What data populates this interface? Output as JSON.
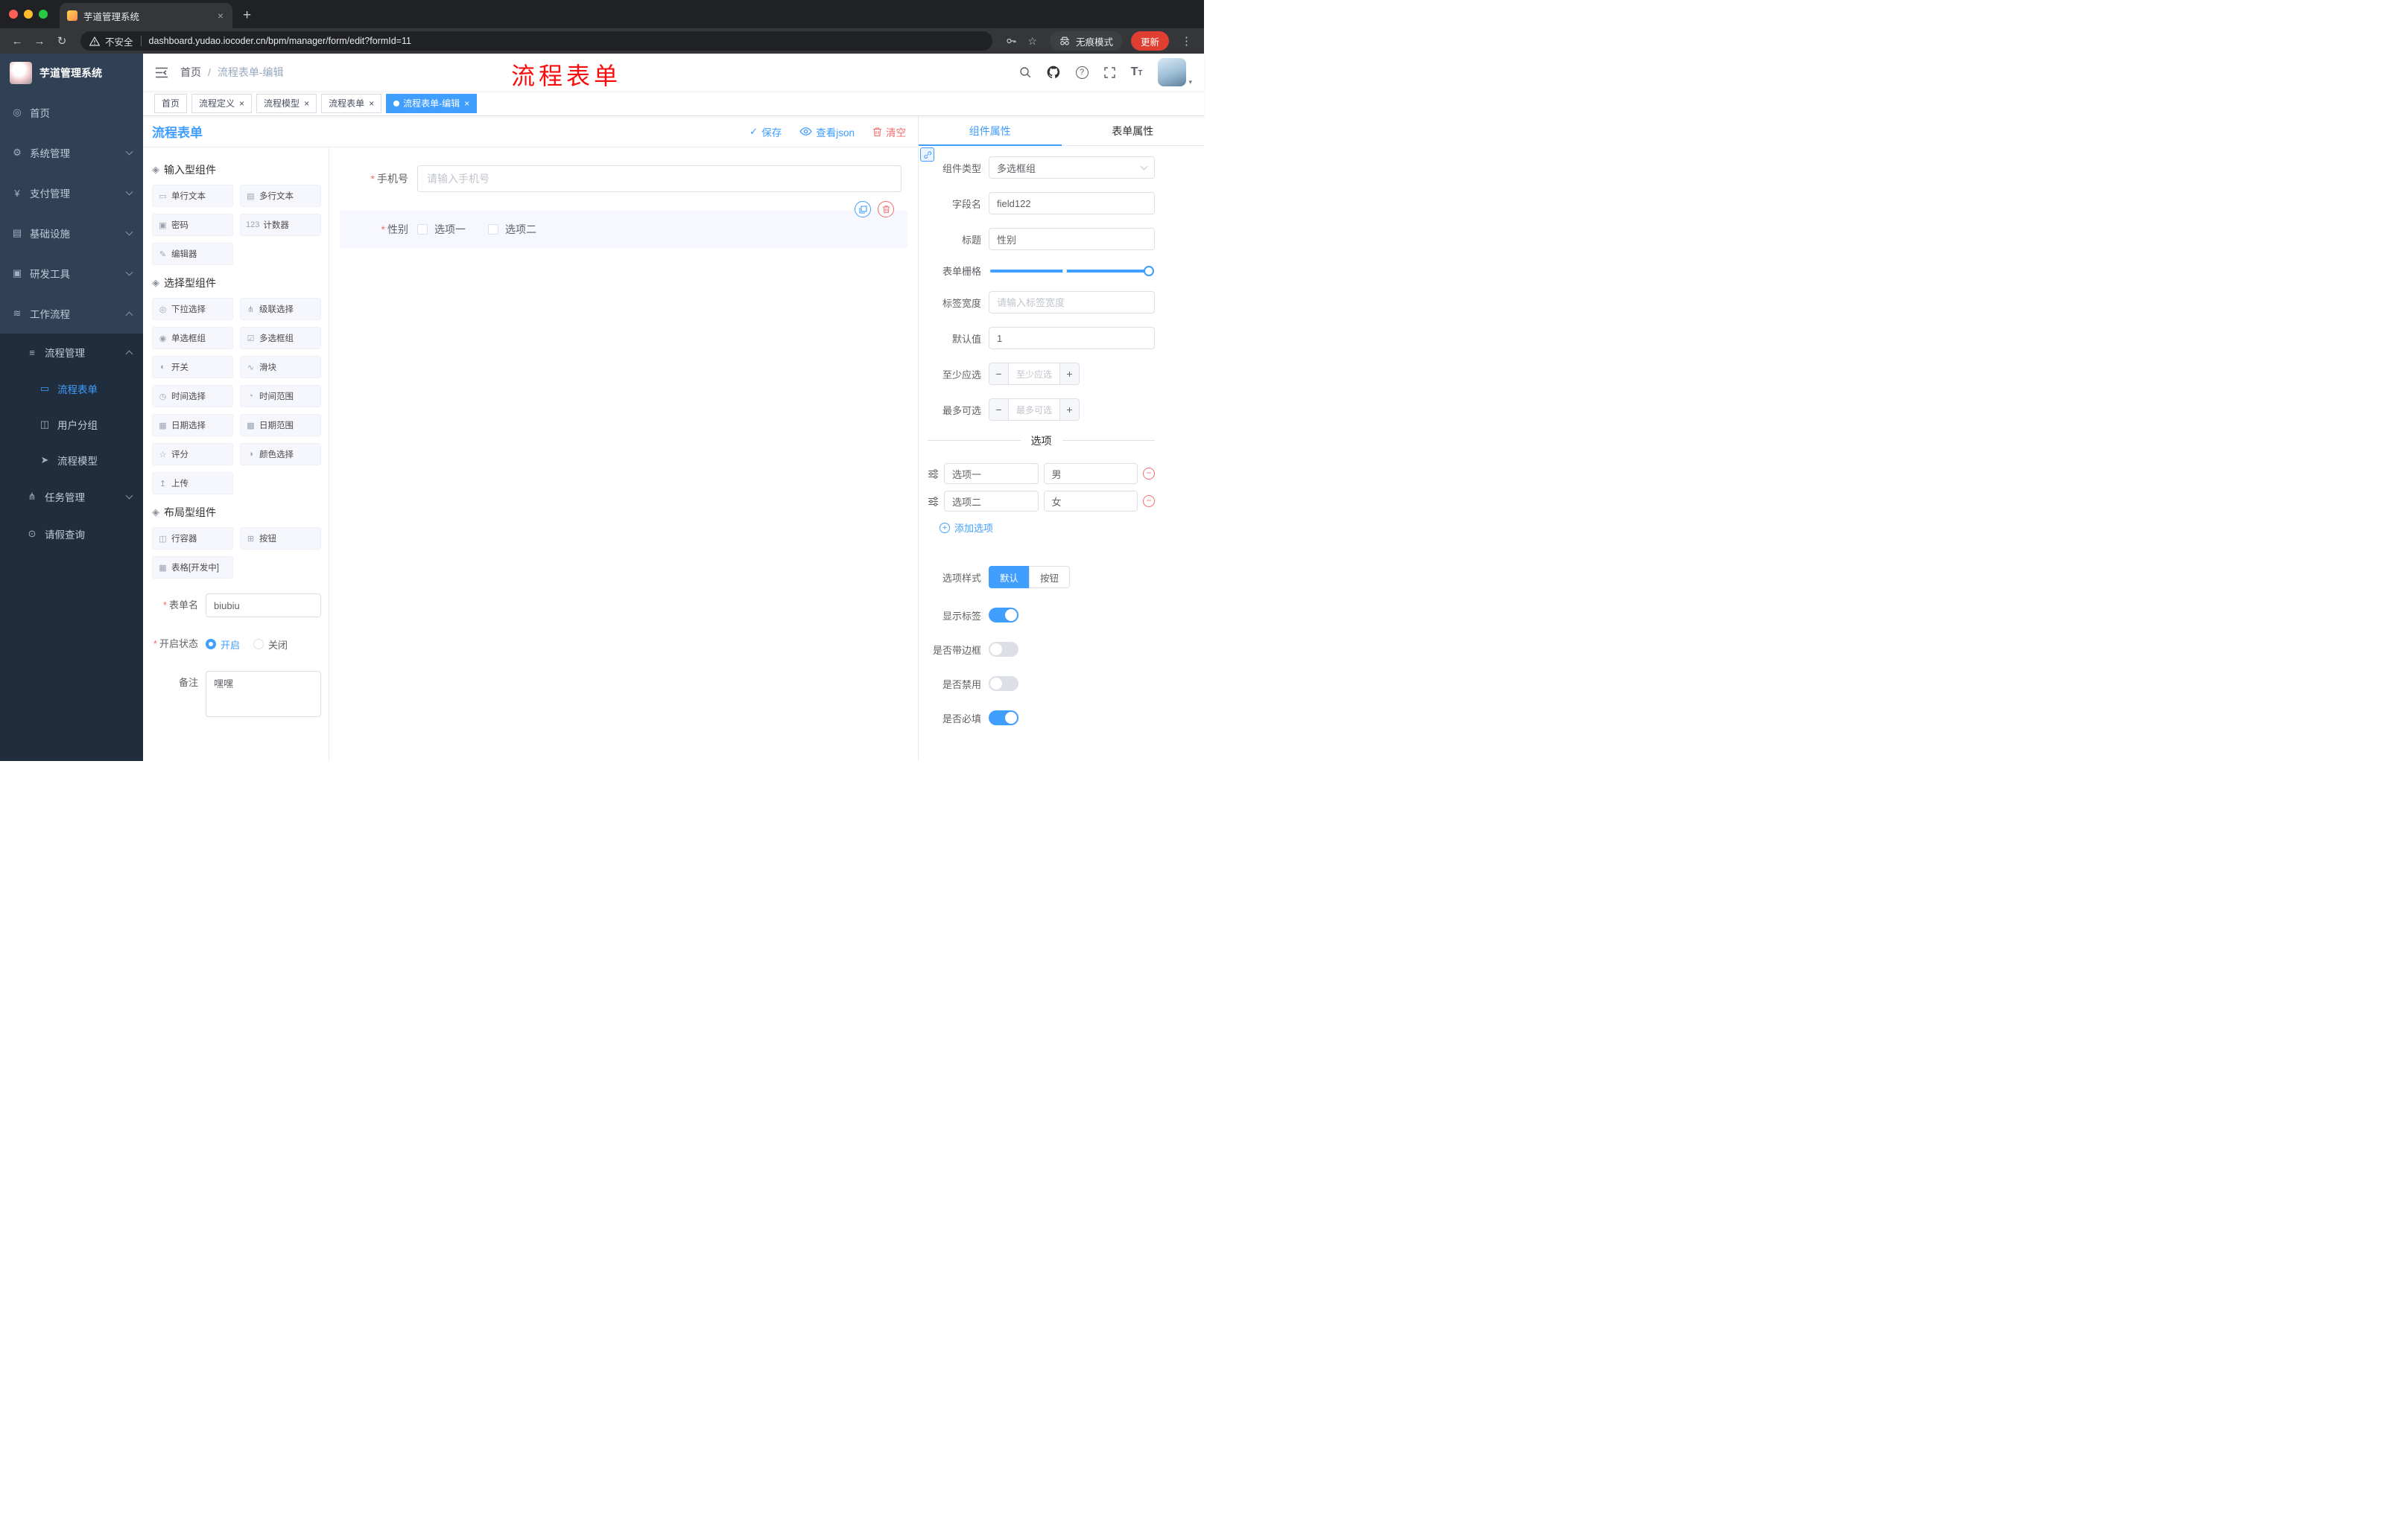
{
  "colors": {
    "accent": "#409eff",
    "danger": "#f56c6c",
    "sidebar_bg": "#304156",
    "submenu_bg": "#1f2d3d",
    "active_tag_bg": "#409eff",
    "update_button_bg": "#df3e30",
    "annotation_color": "#f70d0d"
  },
  "browser": {
    "tab_title": "芋道管理系统",
    "new_tab_label": "+",
    "security_label": "不安全",
    "url": "dashboard.yudao.iocoder.cn/bpm/manager/form/edit?formId=11",
    "incognito_label": "无痕模式",
    "update_label": "更新"
  },
  "icons": {
    "back": "←",
    "forward": "→",
    "reload": "↻",
    "kebab": "⋮",
    "star": "☆",
    "close": "×",
    "check": "✓",
    "question": "?",
    "section": "◈",
    "caret": "▾",
    "minus": "−",
    "plus": "+"
  },
  "annotation": {
    "text": "流程表单"
  },
  "sidebar": {
    "logo_title": "芋道管理系统",
    "items": [
      {
        "label": "首页",
        "icon": "◎"
      },
      {
        "label": "系统管理",
        "icon": "⚙"
      },
      {
        "label": "支付管理",
        "icon": "¥"
      },
      {
        "label": "基础设施",
        "icon": "▤"
      },
      {
        "label": "研发工具",
        "icon": "▣"
      },
      {
        "label": "工作流程",
        "icon": "≋"
      },
      {
        "label": "流程管理",
        "icon": "≡"
      },
      {
        "label": "流程表单",
        "icon": "▭"
      },
      {
        "label": "用户分组",
        "icon": "◫"
      },
      {
        "label": "流程模型",
        "icon": "➤"
      },
      {
        "label": "任务管理",
        "icon": "⋔"
      },
      {
        "label": "请假查询",
        "icon": "⊙"
      }
    ]
  },
  "navbar": {
    "breadcrumb_home": "首页",
    "breadcrumb_sep": "/",
    "breadcrumb_current": "流程表单-编辑"
  },
  "tags": [
    {
      "label": "首页"
    },
    {
      "label": "流程定义"
    },
    {
      "label": "流程模型"
    },
    {
      "label": "流程表单"
    },
    {
      "label": "流程表单-编辑"
    }
  ],
  "designer": {
    "title": "流程表单",
    "save_label": "保存",
    "view_json_label": "查看json",
    "clear_label": "清空"
  },
  "palette": {
    "sections": [
      {
        "title": "输入型组件",
        "items": [
          {
            "label": "单行文本",
            "icon": "▭"
          },
          {
            "label": "多行文本",
            "icon": "▤"
          },
          {
            "label": "密码",
            "icon": "▣"
          },
          {
            "label": "计数器",
            "icon": "123"
          },
          {
            "label": "编辑器",
            "icon": "✎"
          }
        ]
      },
      {
        "title": "选择型组件",
        "items": [
          {
            "label": "下拉选择",
            "icon": "◎"
          },
          {
            "label": "级联选择",
            "icon": "⋔"
          },
          {
            "label": "单选框组",
            "icon": "◉"
          },
          {
            "label": "多选框组",
            "icon": "☑"
          },
          {
            "label": "开关",
            "icon": "◐"
          },
          {
            "label": "滑块",
            "icon": "∿"
          },
          {
            "label": "时间选择",
            "icon": "◷"
          },
          {
            "label": "时间范围",
            "icon": "◔"
          },
          {
            "label": "日期选择",
            "icon": "▦"
          },
          {
            "label": "日期范围",
            "icon": "▩"
          },
          {
            "label": "评分",
            "icon": "☆"
          },
          {
            "label": "颜色选择",
            "icon": "◑"
          },
          {
            "label": "上传",
            "icon": "↥"
          }
        ]
      },
      {
        "title": "布局型组件",
        "items": [
          {
            "label": "行容器",
            "icon": "◫"
          },
          {
            "label": "按钮",
            "icon": "⊞"
          },
          {
            "label": "表格[开发中]",
            "icon": "▦"
          }
        ]
      }
    ]
  },
  "meta_form": {
    "form_name_label": "表单名",
    "form_name_value": "biubiu",
    "status_label": "开启状态",
    "status_on": "开启",
    "status_off": "关闭",
    "remark_label": "备注",
    "remark_value": "嘿嘿"
  },
  "canvas": {
    "phone_label": "手机号",
    "phone_placeholder": "请输入手机号",
    "gender_label": "性别",
    "gender_option1": "选项一",
    "gender_option2": "选项二"
  },
  "props": {
    "tab_component": "组件属性",
    "tab_form": "表单属性",
    "component_type_label": "组件类型",
    "component_type_value": "多选框组",
    "field_name_label": "字段名",
    "field_name_value": "field122",
    "title_label": "标题",
    "title_value": "性别",
    "grid_label": "表单栅格",
    "label_width_label": "标签宽度",
    "label_width_placeholder": "请输入标签宽度",
    "default_label": "默认值",
    "default_value": "1",
    "min_label": "至少应选",
    "min_placeholder": "至少应选",
    "max_label": "最多可选",
    "max_placeholder": "最多可选",
    "options_title": "选项",
    "options": [
      {
        "label": "选项一",
        "value": "男"
      },
      {
        "label": "选项二",
        "value": "女"
      }
    ],
    "add_option_label": "添加选项",
    "option_style_label": "选项样式",
    "option_style_default": "默认",
    "option_style_button": "按钮",
    "toggles": [
      {
        "label": "显示标签",
        "on": true
      },
      {
        "label": "是否带边框",
        "on": false
      },
      {
        "label": "是否禁用",
        "on": false
      },
      {
        "label": "是否必填",
        "on": true
      }
    ]
  }
}
